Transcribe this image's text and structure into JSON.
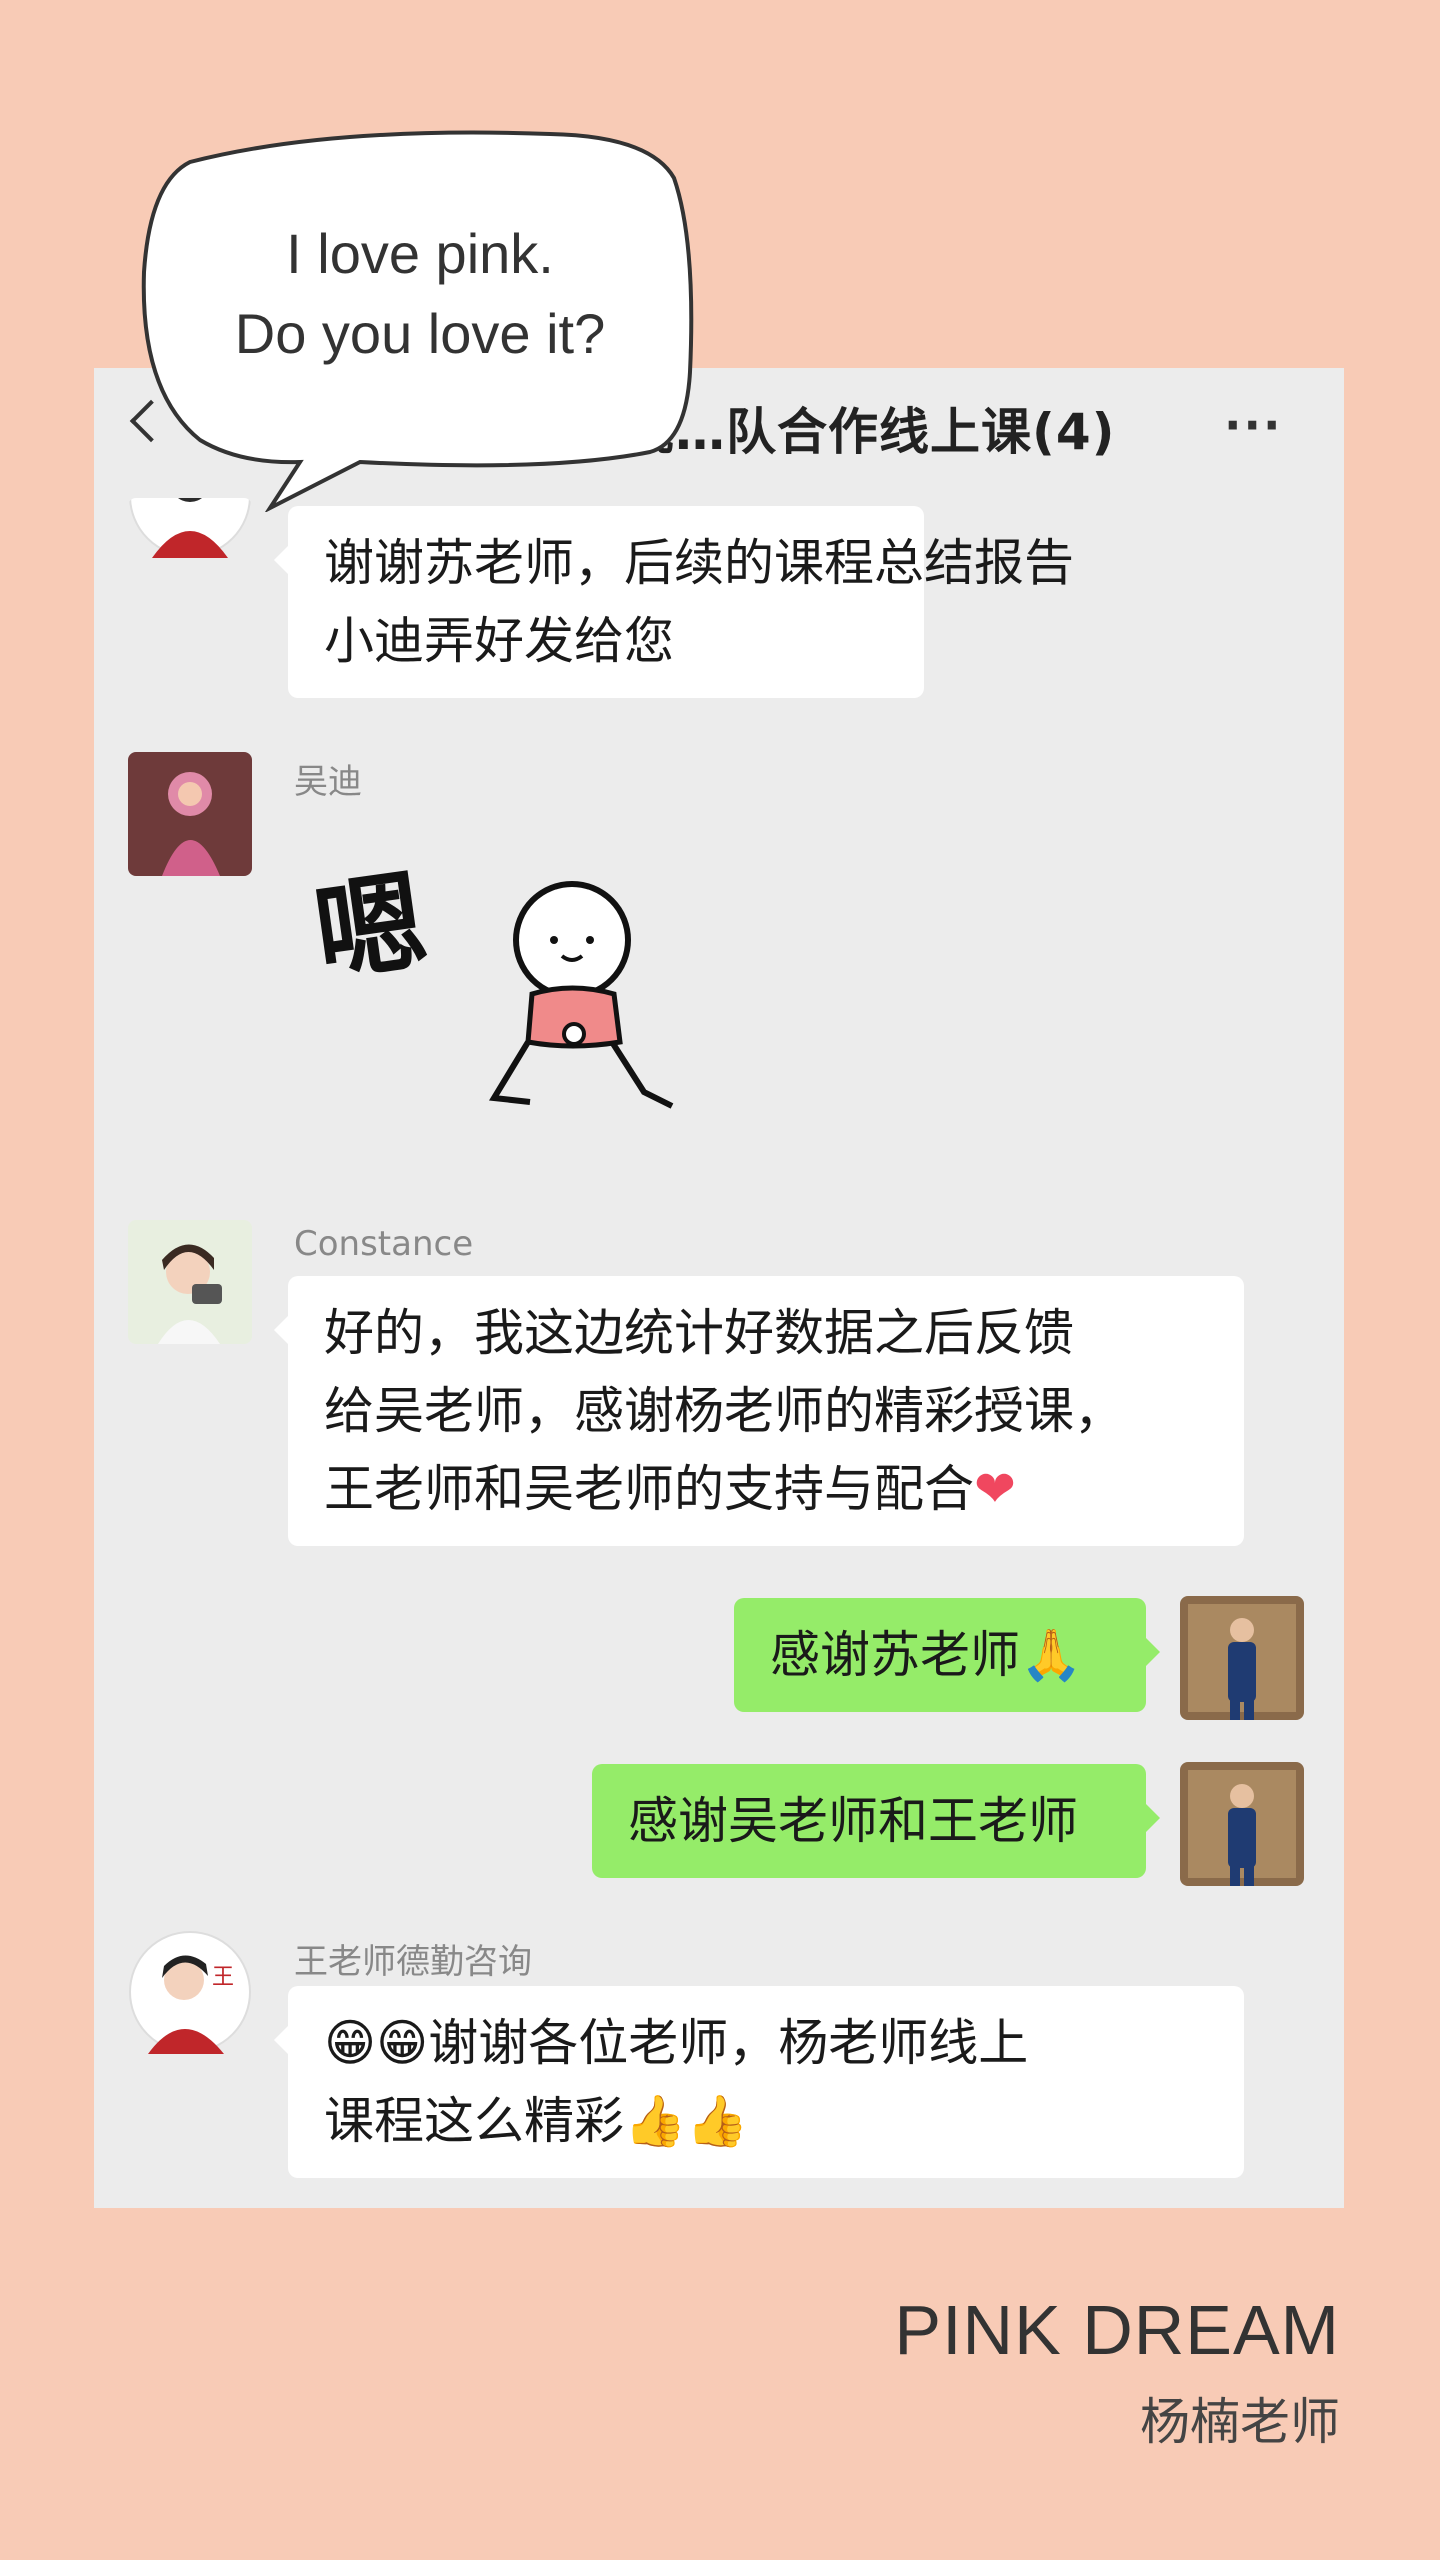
{
  "speech_balloon": {
    "lines": [
      "I love pink.",
      "Do you love it?"
    ]
  },
  "chat": {
    "title": "统…队合作线上课(4)",
    "more_label": "···",
    "messages": [
      {
        "sender": "",
        "side": "left",
        "lines": [
          "谢谢苏老师，后续的课程总结报告",
          "小迪弄好发给您"
        ]
      },
      {
        "sender": "吴迪",
        "side": "left",
        "sticker_text": "嗯"
      },
      {
        "sender": "Constance",
        "side": "left",
        "lines": [
          "好的，我这边统计好数据之后反馈",
          "给吴老师，感谢杨老师的精彩授课，",
          "王老师和吴老师的支持与配合"
        ],
        "trailing_emoji": "❤"
      },
      {
        "sender": "",
        "side": "right",
        "text": "感谢苏老师",
        "trailing_emoji": "🙏"
      },
      {
        "sender": "",
        "side": "right",
        "text": "感谢吴老师和王老师"
      },
      {
        "sender": "王老师德勤咨询",
        "side": "left",
        "lines": [
          "谢谢各位老师，杨老师线上",
          "课程这么精彩"
        ],
        "leading_emoji": "😁😁",
        "trailing_emoji": "👍👍"
      }
    ]
  },
  "footer": {
    "brand": "PINK DREAM",
    "teacher": "杨楠老师"
  },
  "colors": {
    "background": "#f8cbb6",
    "chat_background": "#ececec",
    "bubble_incoming": "#ffffff",
    "bubble_outgoing": "#95ec69"
  }
}
